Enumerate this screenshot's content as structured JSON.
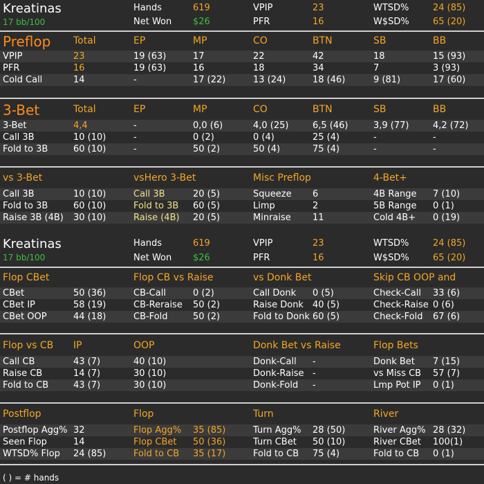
{
  "player1": {
    "name": "Kreatinas",
    "stakes": "17 bb/100",
    "hands_label": "Hands",
    "hands": "619",
    "netwon_label": "Net Won",
    "netwon": "$26",
    "vpip_label": "VPIP",
    "vpip": "23",
    "pfr_label": "PFR",
    "pfr": "16",
    "wtsd_label": "WTSD%",
    "wtsd": "24 (85)",
    "wsd_label": "W$SD%",
    "wsd": "65 (20)"
  },
  "preflop": {
    "title": "Preflop",
    "cols": [
      "Total",
      "EP",
      "MP",
      "CO",
      "BTN",
      "SB",
      "BB"
    ],
    "rows": [
      {
        "label": "VPIP",
        "vals": [
          "23",
          "19 (63)",
          "17",
          "22",
          "42",
          "18",
          "15 (93)"
        ]
      },
      {
        "label": "PFR",
        "vals": [
          "16",
          "19 (63)",
          "16",
          "18",
          "34",
          "7",
          "3 (93)"
        ]
      },
      {
        "label": "Cold Call",
        "vals": [
          "14",
          "-",
          "17 (22)",
          "13 (24)",
          "18 (46)",
          "9 (81)",
          "17 (60)"
        ]
      }
    ]
  },
  "threebet": {
    "title": "3-Bet",
    "cols": [
      "Total",
      "EP",
      "MP",
      "CO",
      "BTN",
      "SB",
      "BB"
    ],
    "rows": [
      {
        "label": "3-Bet",
        "vals": [
          "4,4",
          "-",
          "0,0 (6)",
          "4,0 (25)",
          "6,5 (46)",
          "3,9 (77)",
          "4,2 (72)"
        ]
      },
      {
        "label": "Call 3B",
        "vals": [
          "10 (10)",
          "-",
          "0 (2)",
          "0 (4)",
          "25 (4)",
          "-",
          "-"
        ]
      },
      {
        "label": "Fold to 3B",
        "vals": [
          "60 (10)",
          "-",
          "50 (2)",
          "50 (4)",
          "75 (4)",
          "-",
          "-"
        ]
      }
    ]
  },
  "vs3bet": {
    "titles": [
      "vs 3-Bet",
      "vsHero 3-Bet",
      "Misc Preflop",
      "4-Bet+"
    ],
    "rows": [
      [
        "Call 3B",
        "10 (10)",
        "Call 3B",
        "20 (5)",
        "Squeeze",
        "6",
        "4B Range",
        "7 (10)"
      ],
      [
        "Fold to 3B",
        "60 (10)",
        "Fold to 3B",
        "60 (5)",
        "Limp",
        "2",
        "5B Range",
        "0 (1)"
      ],
      [
        "Raise 3B (4B)",
        "30 (10)",
        "Raise (4B)",
        "20 (5)",
        "Minraise",
        "11",
        "Cold 4B+",
        "0 (19)"
      ]
    ]
  },
  "player2": {
    "name": "Kreatinas",
    "stakes": "17 bb/100",
    "hands_label": "Hands",
    "hands": "619",
    "netwon_label": "Net Won",
    "netwon": "$26",
    "vpip_label": "VPIP",
    "vpip": "23",
    "pfr_label": "PFR",
    "pfr": "16",
    "wtsd_label": "WTSD%",
    "wtsd": "24 (85)",
    "wsd_label": "W$SD%",
    "wsd": "65 (20)"
  },
  "flopcbet": {
    "titles": [
      "Flop CBet",
      "Flop CB vs Raise",
      "vs Donk Bet",
      "Skip CB OOP and"
    ],
    "rows": [
      [
        "CBet",
        "50 (36)",
        "CB-Call",
        "0 (2)",
        "Call Donk",
        "0 (5)",
        "Check-Call",
        "33 (6)"
      ],
      [
        "CBet IP",
        "58 (19)",
        "CB-Reraise",
        "50 (2)",
        "Raise Donk",
        "40 (5)",
        "Check-Raise",
        "0 (6)"
      ],
      [
        "CBet OOP",
        "44 (18)",
        "CB-Fold",
        "50 (2)",
        "Fold to Donk",
        "60 (5)",
        "Check-Fold",
        "67 (6)"
      ]
    ]
  },
  "flopvscb": {
    "titles": [
      "Flop vs CB",
      "IP",
      "OOP",
      "Donk Bet vs Raise",
      "Flop Bets"
    ],
    "rows": [
      [
        "Call CB",
        "43 (7)",
        "40 (10)",
        "Donk-Call",
        "-",
        "Donk Bet",
        "7 (15)"
      ],
      [
        "Raise CB",
        "14 (7)",
        "30 (10)",
        "Donk-Raise",
        "-",
        "vs Miss CB",
        "57 (7)"
      ],
      [
        "Fold to CB",
        "43 (7)",
        "30 (10)",
        "Donk-Fold",
        "-",
        "Lmp Pot IP",
        "0 (1)"
      ]
    ]
  },
  "postflop": {
    "titles": [
      "Postflop",
      "Flop",
      "Turn",
      "River"
    ],
    "rows": [
      [
        "Postflop Agg%",
        "32",
        "Flop Agg%",
        "35 (85)",
        "Turn Agg%",
        "28 (50)",
        "River Agg%",
        "28 (32)"
      ],
      [
        "Seen Flop",
        "14",
        "Flop CBet",
        "50 (36)",
        "Turn CBet",
        "50 (10)",
        "River CBet",
        "100(1)"
      ],
      [
        "WTSD% Flop",
        "24 (85)",
        "Fold to CB",
        "35 (17)",
        "Fold to CB",
        "75 (4)",
        "Fold to CB",
        "0 (1)"
      ]
    ]
  },
  "footer": "( ) = # hands"
}
